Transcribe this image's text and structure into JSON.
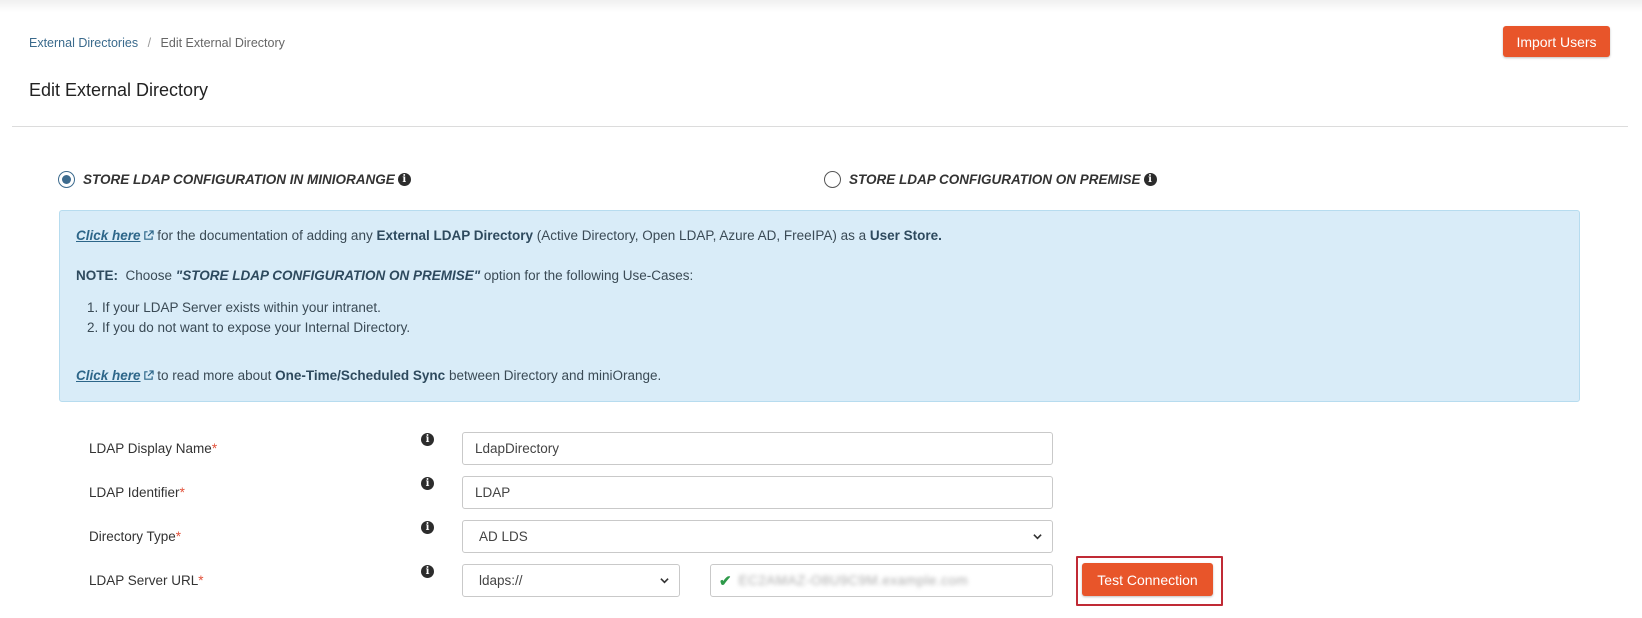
{
  "breadcrumb": {
    "parent": "External Directories",
    "separator": "/",
    "current": "Edit External Directory"
  },
  "header": {
    "import_button": "Import Users",
    "title": "Edit External Directory"
  },
  "storage_options": {
    "miniorange": {
      "label": "STORE LDAP CONFIGURATION IN MINIORANGE",
      "selected": true
    },
    "premise": {
      "label": "STORE LDAP CONFIGURATION ON PREMISE",
      "selected": false
    }
  },
  "info_box": {
    "link1": "Click here",
    "line1_a": " for the documentation of adding any ",
    "line1_b": "External LDAP Directory",
    "line1_c": " (Active Directory, Open LDAP, Azure AD, FreeIPA) as a ",
    "line1_d": "User Store.",
    "note_label": "NOTE:",
    "note_a": "  Choose ",
    "note_option": "\"STORE LDAP CONFIGURATION ON PREMISE\"",
    "note_b": " option for the following Use-Cases:",
    "use_cases": [
      "If your LDAP Server exists within your intranet.",
      "If you do not want to expose your Internal Directory."
    ],
    "link2": "Click here",
    "line3_a": " to read more about ",
    "line3_b": "One-Time/Scheduled Sync",
    "line3_c": " between Directory and miniOrange."
  },
  "form": {
    "display_name": {
      "label": "LDAP Display Name",
      "value": "LdapDirectory"
    },
    "identifier": {
      "label": "LDAP Identifier",
      "value": "LDAP"
    },
    "directory_type": {
      "label": "Directory Type",
      "value": "AD LDS"
    },
    "server_url": {
      "label": "LDAP Server URL",
      "protocol": "ldaps://",
      "host": "EC2AMAZ-O8U9C9M.example.com"
    },
    "required_mark": "*"
  },
  "test_button": "Test Connection",
  "colors": {
    "accent": "#e8552a",
    "link": "#2d6689",
    "info_bg": "#d9ecf8",
    "highlight_frame": "#c02a35",
    "check": "#2e9a4a"
  }
}
